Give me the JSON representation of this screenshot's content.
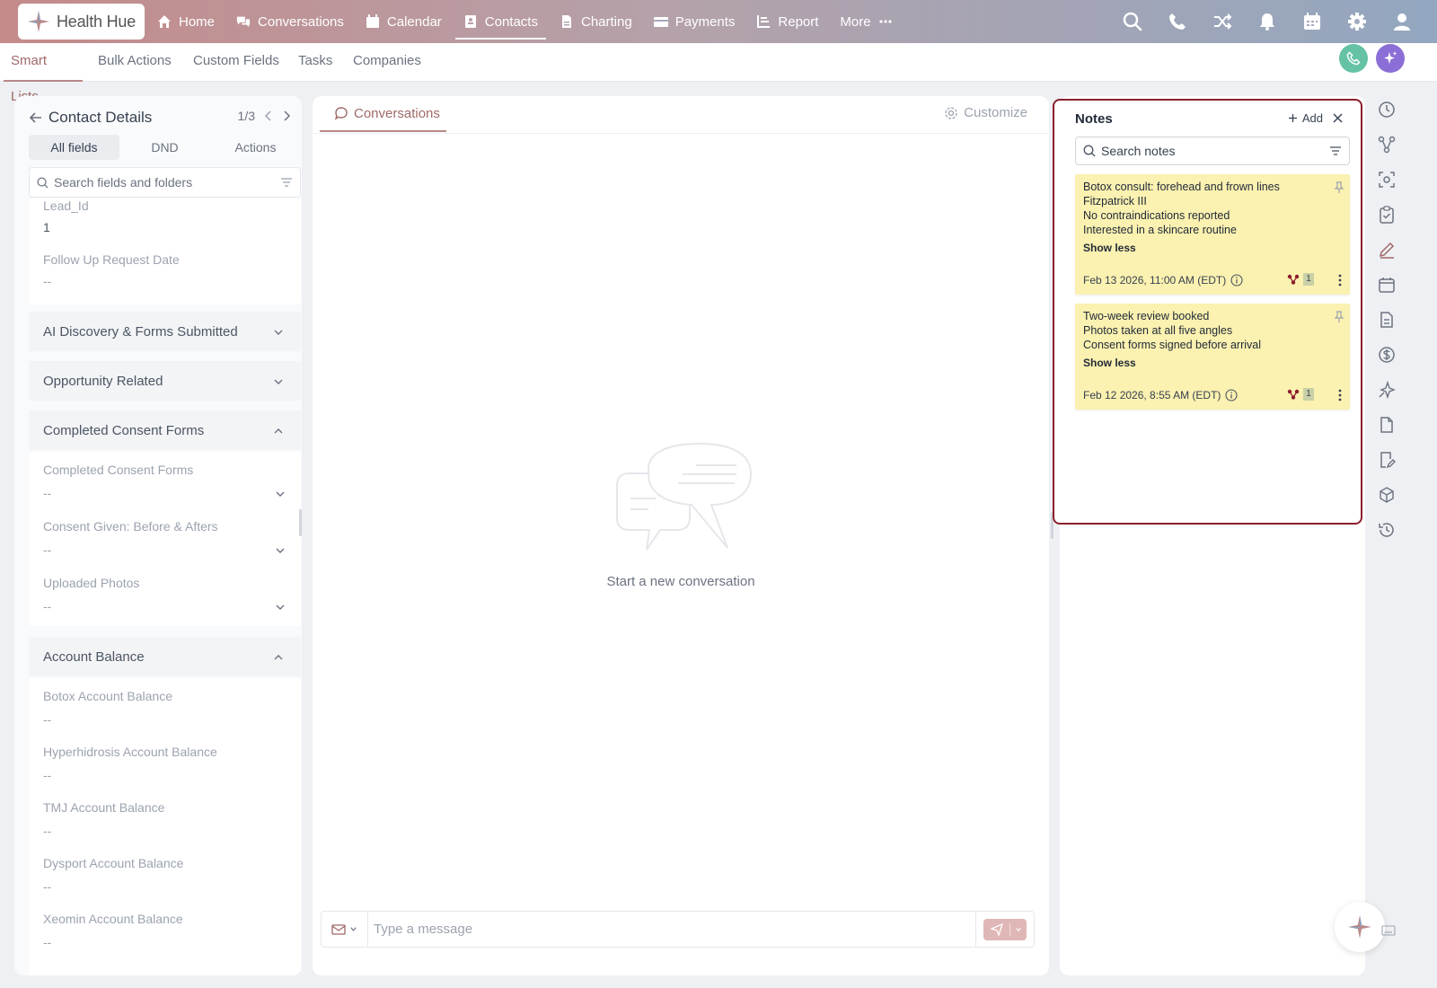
{
  "app": {
    "logo_text": "Health Hue"
  },
  "nav": {
    "items": [
      {
        "label": "Home",
        "icon": "home-icon"
      },
      {
        "label": "Conversations",
        "icon": "chat-icon"
      },
      {
        "label": "Calendar",
        "icon": "calendar-icon"
      },
      {
        "label": "Contacts",
        "icon": "contact-card-icon",
        "active": true
      },
      {
        "label": "Charting",
        "icon": "document-icon"
      },
      {
        "label": "Payments",
        "icon": "credit-card-icon"
      },
      {
        "label": "Report",
        "icon": "report-icon"
      },
      {
        "label": "More",
        "icon": "ellipsis-icon"
      }
    ],
    "right_icons": [
      "search-icon",
      "phone-icon",
      "shuffle-icon",
      "bell-icon",
      "calendar-grid-icon",
      "gear-icon",
      "user-icon"
    ]
  },
  "subnav": {
    "tabs": [
      {
        "label": "Smart Lists",
        "active": true
      },
      {
        "label": "Bulk Actions"
      },
      {
        "label": "Custom Fields"
      },
      {
        "label": "Tasks"
      },
      {
        "label": "Companies"
      }
    ]
  },
  "contact_panel": {
    "title": "Contact Details",
    "pager": "1/3",
    "tabs": [
      "All fields",
      "DND",
      "Actions"
    ],
    "search_placeholder": "Search fields and folders",
    "fields_top": [
      {
        "label": "Lead_Id",
        "value": "1"
      },
      {
        "label": "Follow Up Request Date",
        "value": "--"
      }
    ],
    "sections": [
      {
        "label": "AI Discovery & Forms Submitted",
        "expanded": false
      },
      {
        "label": "Opportunity Related",
        "expanded": false
      },
      {
        "label": "Completed Consent Forms",
        "expanded": true
      },
      {
        "label": "Account Balance",
        "expanded": true
      }
    ],
    "consent_fields": [
      {
        "label": "Completed Consent Forms",
        "value": "--"
      },
      {
        "label": "Consent Given: Before & Afters",
        "value": "--"
      },
      {
        "label": "Uploaded Photos",
        "value": "--"
      }
    ],
    "balance_fields": [
      {
        "label": "Botox Account Balance",
        "value": "--"
      },
      {
        "label": "Hyperhidrosis Account Balance",
        "value": "--"
      },
      {
        "label": "TMJ Account Balance",
        "value": "--"
      },
      {
        "label": "Dysport Account Balance",
        "value": "--"
      },
      {
        "label": "Xeomin Account Balance",
        "value": "--"
      }
    ]
  },
  "conversations": {
    "tab_label": "Conversations",
    "customize_label": "Customize",
    "empty_text": "Start a new conversation",
    "composer_placeholder": "Type a message"
  },
  "notes": {
    "title": "Notes",
    "add_label": "Add",
    "search_placeholder": "Search notes",
    "items": [
      {
        "lines": [
          "Botox consult: forehead and frown lines",
          "Fitzpatrick III",
          "No contraindications reported",
          "Interested in a skincare routine"
        ],
        "toggle": "Show less",
        "date": "Feb 13 2026, 11:00 AM (EDT)",
        "count": "1"
      },
      {
        "lines": [
          "Two-week review booked",
          "Photos taken at all five angles",
          "Consent forms signed before arrival"
        ],
        "toggle": "Show less",
        "date": "Feb 12 2026, 8:55 AM (EDT)",
        "count": "1"
      }
    ]
  },
  "rail_icons": [
    "history-icon",
    "workflow-icon",
    "scan-icon",
    "clipboard-check-icon",
    "pen-icon",
    "calendar-icon",
    "document-icon",
    "dollar-icon",
    "sparkle-pin-icon",
    "file-icon",
    "file-edit-icon",
    "cube-icon",
    "restore-icon"
  ],
  "colors": {
    "accent": "#a06868",
    "note_bg": "#fbf1b0",
    "notes_border": "#8b1e2c",
    "call_fab": "#66c2a5",
    "ai_fab": "#8b6fd6"
  }
}
